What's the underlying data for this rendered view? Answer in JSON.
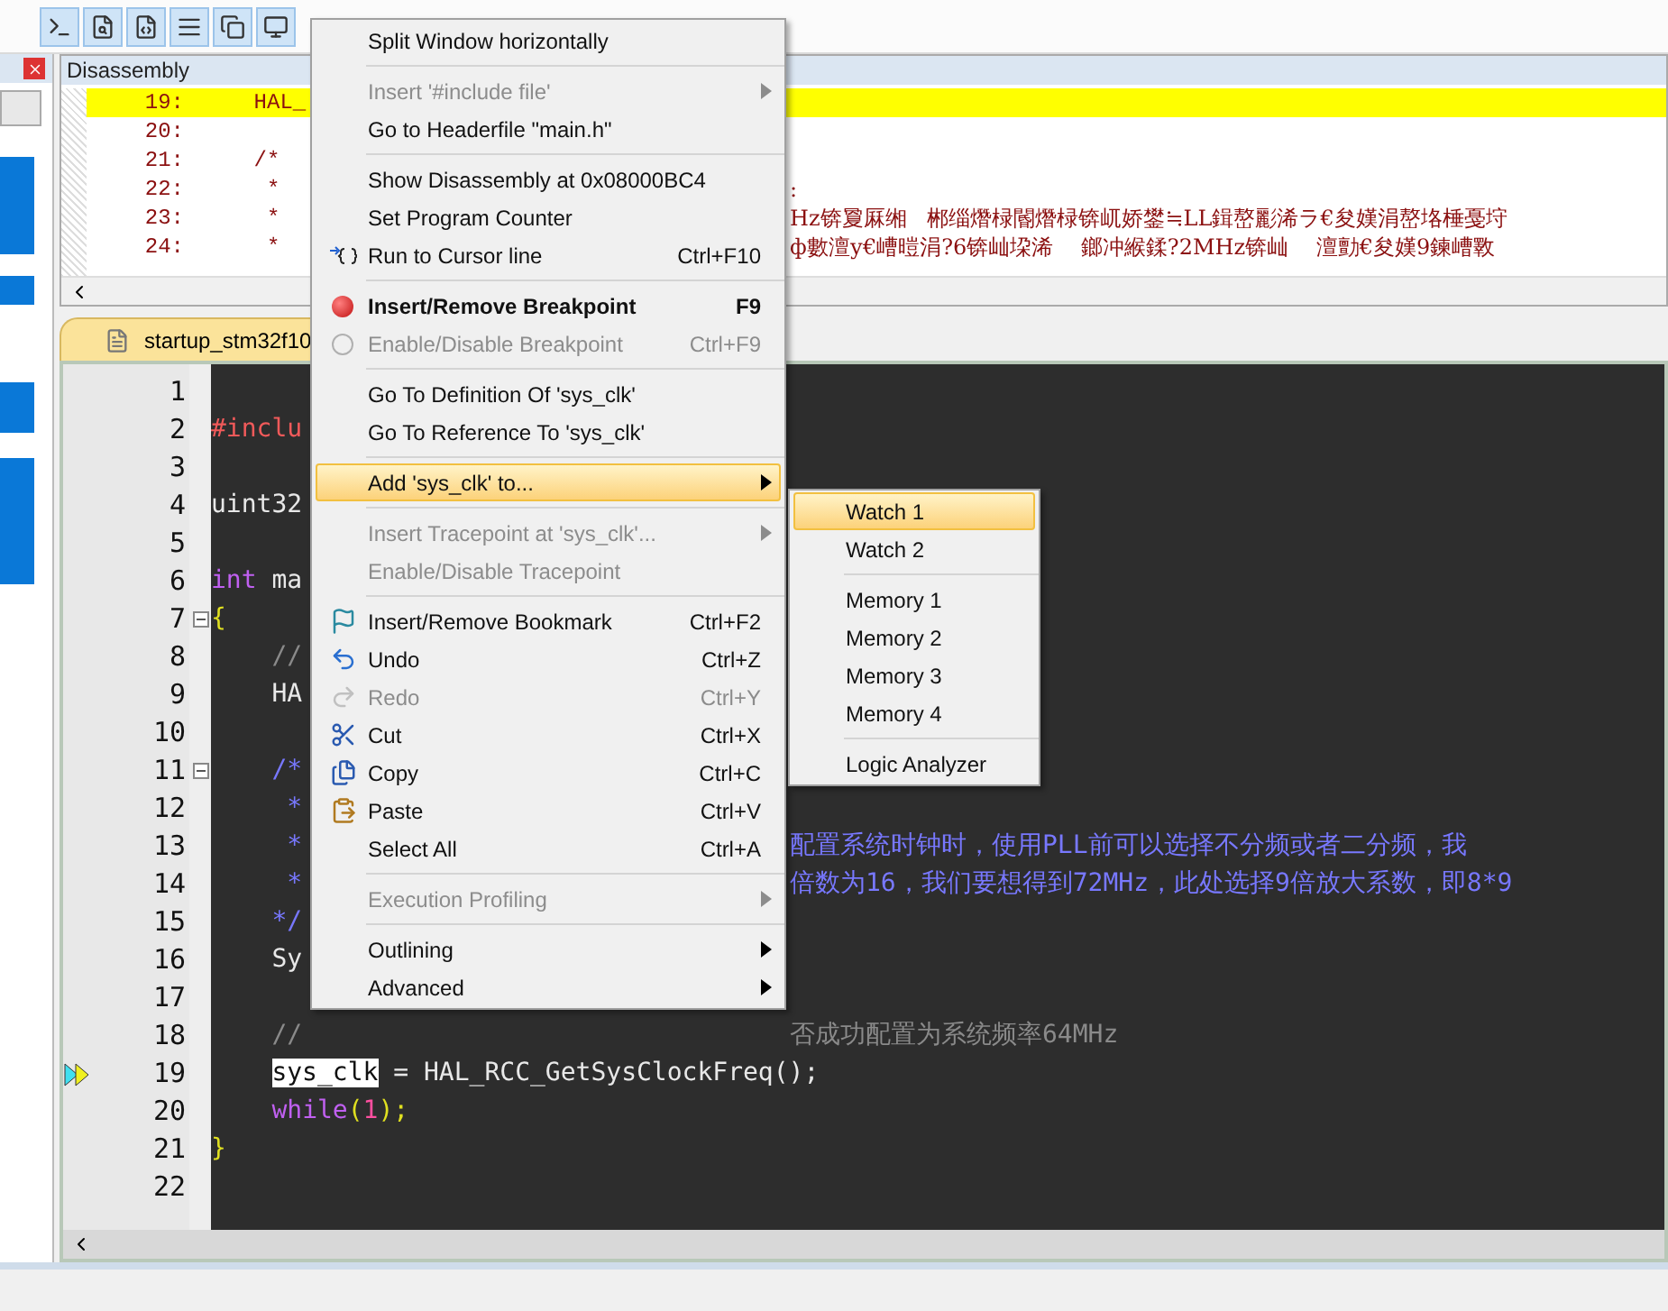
{
  "disassembly": {
    "title": "Disassembly",
    "rows": [
      {
        "num": "19:",
        "text": "    HAL_",
        "current": true
      },
      {
        "num": "20:",
        "current": false
      },
      {
        "num": "21:",
        "text": "    /*",
        "current": false
      },
      {
        "num": "22:",
        "text": "     *",
        "right": ":",
        "current": false
      },
      {
        "num": "23:",
        "text": "     *",
        "right": "Hz锛夐厤缃   郴缁熸椂閽熸椂锛屼娇鐢≒LL鍓嶅彲浠ラ€夋嫨涓嶅垎棰戞垨",
        "current": false
      },
      {
        "num": "24:",
        "text": "     *",
        "right": "ф數澶у€嶆暟涓?6锛屾垜浠    鎯冲緱鍒?2MHz锛屾    澶勯€夋嫨9鍊嶆斁",
        "current": false
      }
    ]
  },
  "editor": {
    "tab": "startup_stm32f10",
    "lines": [
      {
        "num": "1",
        "current": false,
        "fold": false
      },
      {
        "num": "2",
        "current": false,
        "fold": false,
        "tokens": [
          {
            "kind": "preproc",
            "text": "#inclu"
          }
        ]
      },
      {
        "num": "3",
        "current": false,
        "fold": false
      },
      {
        "num": "4",
        "current": false,
        "fold": false,
        "tokens": [
          {
            "kind": "plain",
            "text": "uint32"
          }
        ]
      },
      {
        "num": "5",
        "current": false,
        "fold": false
      },
      {
        "num": "6",
        "current": false,
        "fold": false,
        "tokens": [
          {
            "kind": "keyword",
            "text": "int"
          },
          {
            "kind": "plain",
            "text": " ma"
          }
        ]
      },
      {
        "num": "7",
        "current": false,
        "fold": true,
        "tokens": [
          {
            "kind": "brace",
            "text": "{"
          }
        ]
      },
      {
        "num": "8",
        "current": false,
        "fold": false,
        "tokens": [
          {
            "kind": "comment",
            "text": "    //"
          }
        ]
      },
      {
        "num": "9",
        "current": false,
        "fold": false,
        "tokens": [
          {
            "kind": "plain",
            "text": "    HA"
          }
        ]
      },
      {
        "num": "10",
        "current": false,
        "fold": false
      },
      {
        "num": "11",
        "current": false,
        "fold": true,
        "tokens": [
          {
            "kind": "doc",
            "text": "    /*"
          }
        ]
      },
      {
        "num": "12",
        "current": false,
        "fold": false,
        "tokens": [
          {
            "kind": "doc",
            "text": "     *"
          }
        ]
      },
      {
        "num": "13",
        "current": false,
        "fold": false,
        "tokens": [
          {
            "kind": "doc",
            "text": "     *"
          }
        ],
        "right": {
          "kind": "doc",
          "text": "配置系统时钟时，使用PLL前可以选择不分频或者二分频，我"
        }
      },
      {
        "num": "14",
        "current": false,
        "fold": false,
        "tokens": [
          {
            "kind": "doc",
            "text": "     *"
          }
        ],
        "right": {
          "kind": "doc",
          "text": "倍数为16，我们要想得到72MHz，此处选择9倍放大系数，即8*9"
        }
      },
      {
        "num": "15",
        "current": false,
        "fold": false,
        "tokens": [
          {
            "kind": "doc",
            "text": "    */"
          }
        ]
      },
      {
        "num": "16",
        "current": false,
        "fold": false,
        "tokens": [
          {
            "kind": "plain",
            "text": "    Sy"
          }
        ]
      },
      {
        "num": "17",
        "current": false,
        "fold": false
      },
      {
        "num": "18",
        "current": false,
        "fold": false,
        "tokens": [
          {
            "kind": "comment",
            "text": "    //"
          }
        ],
        "right": {
          "kind": "comment",
          "text": "否成功配置为系统频率64MHz"
        }
      },
      {
        "num": "19",
        "current": true,
        "fold": false,
        "indent": true,
        "tokens": [
          {
            "kind": "selection",
            "text": "sys_clk"
          },
          {
            "kind": "plain",
            "text": " = HAL_RCC_GetSysClockFreq();"
          }
        ]
      },
      {
        "num": "20",
        "current": false,
        "fold": false,
        "tokens": [
          {
            "kind": "keyword",
            "text": "    while"
          },
          {
            "kind": "brace",
            "text": "("
          },
          {
            "kind": "number",
            "text": "1"
          },
          {
            "kind": "brace",
            "text": ");"
          }
        ]
      },
      {
        "num": "21",
        "current": false,
        "fold": false,
        "tokens": [
          {
            "kind": "brace",
            "text": "}"
          }
        ]
      },
      {
        "num": "22",
        "current": false,
        "fold": false
      }
    ]
  },
  "menu": {
    "items": [
      {
        "kind": "item",
        "label": "Split Window horizontally",
        "disabled": false,
        "selected": false
      },
      {
        "kind": "separator"
      },
      {
        "kind": "item",
        "label": "Insert '#include file'",
        "disabled": true,
        "submenu": true,
        "selected": false
      },
      {
        "kind": "item",
        "label": "Go to Headerfile \"main.h\"",
        "disabled": false,
        "selected": false
      },
      {
        "kind": "separator"
      },
      {
        "kind": "item",
        "label": "Show Disassembly at 0x08000BC4",
        "disabled": false,
        "selected": false
      },
      {
        "kind": "item",
        "label": "Set Program Counter",
        "disabled": false,
        "selected": false
      },
      {
        "kind": "run",
        "label": "Run to Cursor line",
        "shortcut": "Ctrl+F10",
        "disabled": false,
        "selected": false
      },
      {
        "kind": "separator"
      },
      {
        "kind": "breakpoint",
        "label": "Insert/Remove Breakpoint",
        "shortcut": "F9",
        "bold": true,
        "disabled": false,
        "selected": false
      },
      {
        "kind": "breakpoint",
        "label": "Enable/Disable Breakpoint",
        "shortcut": "Ctrl+F9",
        "disabled": true,
        "selected": false
      },
      {
        "kind": "separator"
      },
      {
        "kind": "item",
        "label": "Go To Definition Of 'sys_clk'",
        "disabled": false,
        "selected": false
      },
      {
        "kind": "item",
        "label": "Go To Reference To 'sys_clk'",
        "disabled": false,
        "selected": false
      },
      {
        "kind": "separator"
      },
      {
        "kind": "item",
        "label": "Add 'sys_clk' to...",
        "submenu": true,
        "disabled": false,
        "selected": true
      },
      {
        "kind": "separator"
      },
      {
        "kind": "item",
        "label": "Insert Tracepoint at 'sys_clk'...",
        "submenu": true,
        "disabled": true,
        "selected": false
      },
      {
        "kind": "item",
        "label": "Enable/Disable Tracepoint",
        "disabled": true,
        "selected": false
      },
      {
        "kind": "separator"
      },
      {
        "kind": "bookmark",
        "label": "Insert/Remove Bookmark",
        "shortcut": "Ctrl+F2",
        "disabled": false,
        "selected": false
      },
      {
        "kind": "undo",
        "label": "Undo",
        "shortcut": "Ctrl+Z",
        "disabled": false,
        "selected": false
      },
      {
        "kind": "redo",
        "label": "Redo",
        "shortcut": "Ctrl+Y",
        "disabled": true,
        "selected": false
      },
      {
        "kind": "cut",
        "label": "Cut",
        "shortcut": "Ctrl+X",
        "disabled": false,
        "selected": false
      },
      {
        "kind": "copy",
        "label": "Copy",
        "shortcut": "Ctrl+C",
        "disabled": false,
        "selected": false
      },
      {
        "kind": "paste",
        "label": "Paste",
        "shortcut": "Ctrl+V",
        "disabled": false,
        "selected": false
      },
      {
        "kind": "item",
        "label": "Select All",
        "shortcut": "Ctrl+A",
        "disabled": false,
        "selected": false
      },
      {
        "kind": "separator"
      },
      {
        "kind": "item",
        "label": "Execution Profiling",
        "submenu": true,
        "disabled": true,
        "selected": false
      },
      {
        "kind": "separator"
      },
      {
        "kind": "item",
        "label": "Outlining",
        "submenu": true,
        "disabled": false,
        "selected": false
      },
      {
        "kind": "item",
        "label": "Advanced",
        "submenu": true,
        "disabled": false,
        "selected": false
      }
    ]
  },
  "submenu": {
    "items": [
      {
        "kind": "item",
        "label": "Watch 1",
        "selected": true
      },
      {
        "kind": "item",
        "label": "Watch 2",
        "selected": false
      },
      {
        "kind": "separator"
      },
      {
        "kind": "item",
        "label": "Memory 1",
        "selected": false
      },
      {
        "kind": "item",
        "label": "Memory 2",
        "selected": false
      },
      {
        "kind": "item",
        "label": "Memory 3",
        "selected": false
      },
      {
        "kind": "item",
        "label": "Memory 4",
        "selected": false
      },
      {
        "kind": "separator"
      },
      {
        "kind": "item",
        "label": "Logic Analyzer",
        "selected": false
      }
    ]
  }
}
